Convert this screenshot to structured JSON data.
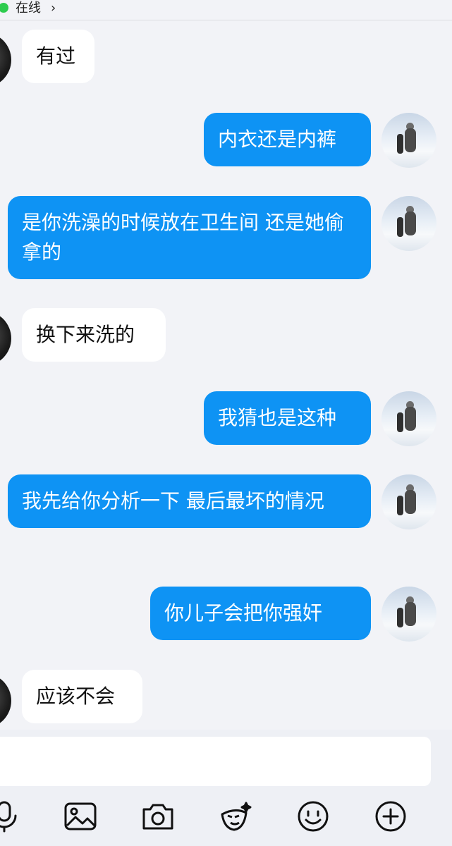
{
  "header": {
    "status_label": "在线",
    "status_chevron": "›",
    "status_color": "#2ecc4f"
  },
  "colors": {
    "outgoing_bubble": "#0e93f4",
    "incoming_bubble": "#ffffff",
    "background": "#f2f3f7"
  },
  "messages": [
    {
      "side": "in",
      "text": "有过"
    },
    {
      "side": "out",
      "text": "内衣还是内裤"
    },
    {
      "side": "out",
      "text": "是你洗澡的时候放在卫生间 还是她偷拿的"
    },
    {
      "side": "in",
      "text": "换下来洗的"
    },
    {
      "side": "out",
      "text": "我猜也是这种"
    },
    {
      "side": "out",
      "text": "我先给你分析一下 最后最坏的情况"
    },
    {
      "side": "out",
      "text": "你儿子会把你强奸"
    },
    {
      "side": "in",
      "text": "应该不会"
    }
  ],
  "input": {
    "placeholder": ""
  },
  "toolbar": [
    {
      "name": "microphone-icon"
    },
    {
      "name": "image-icon"
    },
    {
      "name": "camera-icon"
    },
    {
      "name": "sticker-icon"
    },
    {
      "name": "emoji-icon"
    },
    {
      "name": "plus-icon"
    }
  ]
}
